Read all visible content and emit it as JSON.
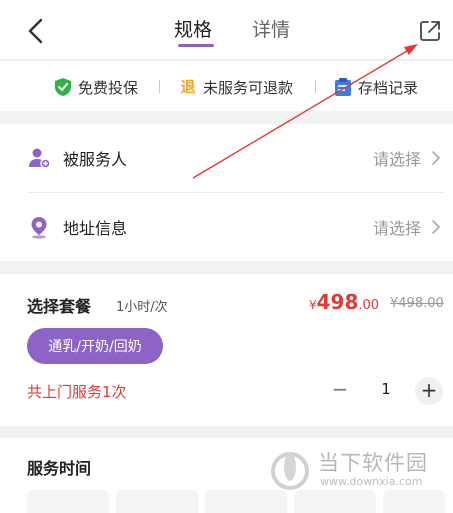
{
  "header": {
    "tabs": [
      {
        "label": "规格",
        "active": true
      },
      {
        "label": "详情",
        "active": false
      }
    ]
  },
  "guarantees": [
    {
      "label": "免费投保",
      "icon": "shield-check-icon",
      "color": "#2fb344"
    },
    {
      "label": "未服务可退款",
      "icon": "refund-icon",
      "color": "#f5a623",
      "glyph": "退"
    },
    {
      "label": "存档记录",
      "icon": "clipboard-icon",
      "color": "#3d7be5"
    }
  ],
  "rows": [
    {
      "label": "被服务人",
      "value": "请选择",
      "icon": "person-add-icon"
    },
    {
      "label": "地址信息",
      "value": "请选择",
      "icon": "location-pin-icon"
    }
  ],
  "package": {
    "title": "选择套餐",
    "unit": "1小时/次",
    "price": {
      "currency": "¥",
      "integer": "498",
      "decimal": ".00"
    },
    "original_price": "¥498.00",
    "option": "通乳/开奶/回奶",
    "visit_text": "共上门服务1次",
    "quantity": "1",
    "minus": "−",
    "plus": "+"
  },
  "service_time": {
    "title": "服务时间"
  },
  "watermark": {
    "name": "当下软件园",
    "url": "www.downxia.com"
  },
  "colors": {
    "accent": "#8e63c6",
    "price": "#e53935",
    "annotation_arrow": "#e53935"
  }
}
